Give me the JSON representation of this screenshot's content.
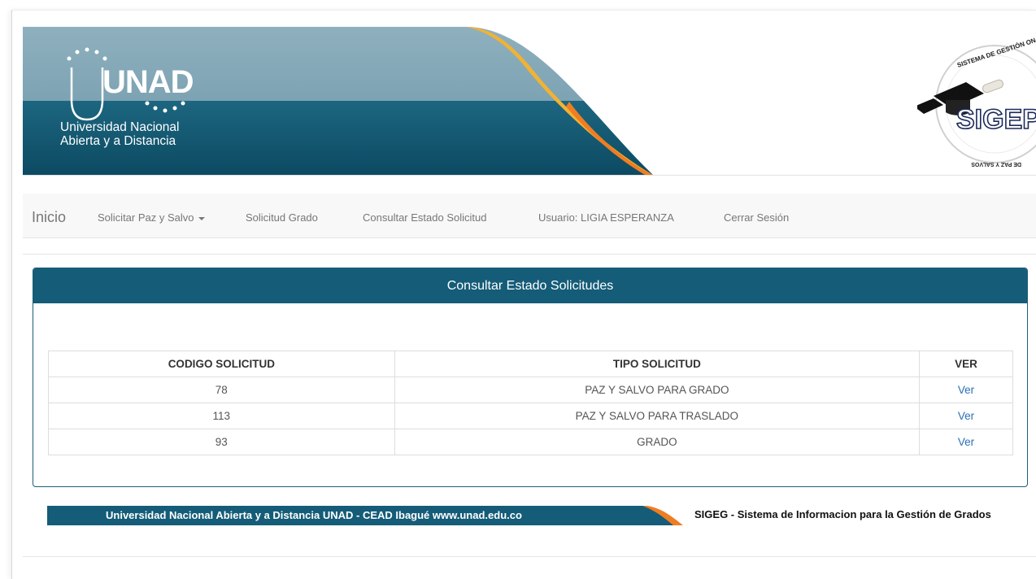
{
  "header": {
    "logo_text": "UNAD",
    "logo_line1": "Universidad Nacional",
    "logo_line2": "Abierta y a Distancia",
    "seal_top_text": "SISTEMA DE GESTIÓN ON-LINE",
    "seal_main_text": "SIGEP",
    "seal_bottom_text": "DE PAZ Y SALVOS"
  },
  "nav": {
    "brand": "Inicio",
    "items": [
      "Solicitar Paz y Salvo",
      "Solicitud Grado",
      "Consultar Estado Solicitud",
      "Usuario: LIGIA ESPERANZA",
      "Cerrar Sesión"
    ]
  },
  "panel": {
    "title": "Consultar Estado Solicitudes",
    "columns": [
      "CODIGO SOLICITUD",
      "TIPO SOLICITUD",
      "VER"
    ],
    "rows": [
      {
        "codigo": "78",
        "tipo": "PAZ Y SALVO PARA GRADO",
        "ver": "Ver"
      },
      {
        "codigo": "113",
        "tipo": "PAZ Y SALVO PARA TRASLADO",
        "ver": "Ver"
      },
      {
        "codigo": "93",
        "tipo": "GRADO",
        "ver": "Ver"
      }
    ]
  },
  "footer": {
    "left": "Universidad Nacional Abierta y a Distancia UNAD - CEAD Ibagué www.unad.edu.co",
    "right": "SIGEG - Sistema de Informacion para la Gestión de Grados"
  },
  "colors": {
    "banner_dark": "#0f5069",
    "banner_light": "#7fa6b6",
    "accent_orange": "#ef7d22",
    "panel_header": "#155c78",
    "link": "#2a6fb5"
  }
}
